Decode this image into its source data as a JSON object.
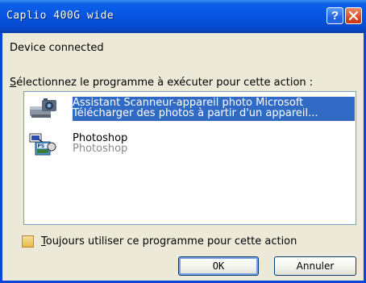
{
  "window": {
    "title": "Caplio 400G wide",
    "help_label": "?"
  },
  "device_status": "Device connected",
  "instruction": "Sélectionnez le programme à exécuter pour cette action :",
  "programs": [
    {
      "name": "Assistant Scanneur-appareil photo Microsoft",
      "description": "Télécharger des photos à partir d'un appareil...",
      "icon": "camera-scanner-icon",
      "selected": true
    },
    {
      "name": "Photoshop",
      "description": "Photoshop",
      "icon": "photoshop-icon",
      "selected": false
    }
  ],
  "always_use": {
    "label": "Toujours utiliser ce programme pour cette action",
    "checked": false
  },
  "buttons": {
    "ok": "OK",
    "cancel": "Annuler"
  },
  "colors": {
    "titlebar": "#0754e0",
    "selection": "#316ac5",
    "dialog_bg": "#ece9d8"
  }
}
